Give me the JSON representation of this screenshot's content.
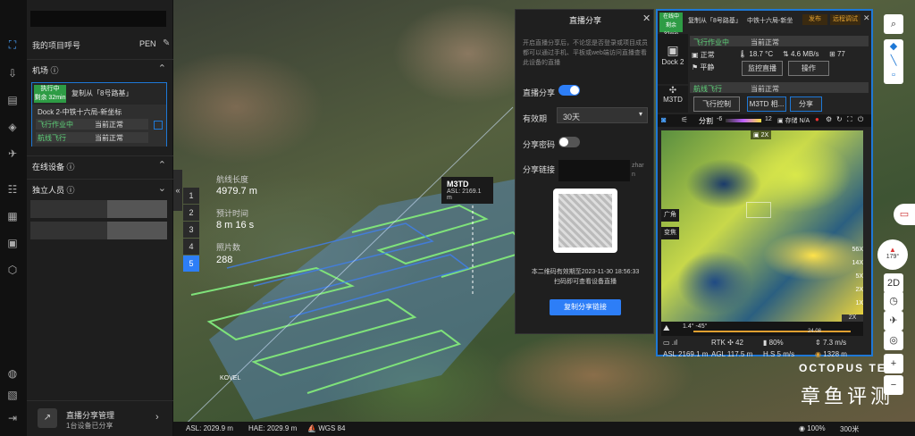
{
  "panel": {
    "project_title": "我的项目呼号",
    "user": "PEN",
    "dock_section": "机场",
    "dock_card": {
      "status_badge": "执行中",
      "time_badge": "剩余 32min",
      "task": "复制从「8号路基」",
      "name": "Dock 2-中铁十六局-新坐标",
      "row1_left": "飞行作业中",
      "row1_right": "当前正常",
      "row2_left": "航线飞行",
      "row2_right": "当前正常"
    },
    "online_section": "在线设备",
    "personnel_section": "独立人员",
    "live_manage": "直播分享管理",
    "live_sub": "1台设备已分享"
  },
  "map": {
    "m3td_label": "M3TD",
    "m3td_asl": "ASL: 2169.1 m",
    "route_length_label": "航线长度",
    "route_length": "4979.7 m",
    "est_time_label": "预计时间",
    "est_time": "8 m 16 s",
    "photo_count_label": "照片数",
    "photo_count": "288",
    "waypoints": [
      "1",
      "2",
      "3",
      "4",
      "5"
    ],
    "place_label": "KOVEL",
    "watermark_en": "OCTOPUS TEST",
    "watermark_cn": "章鱼评测"
  },
  "share_dialog": {
    "title": "直播分享",
    "desc": "开启直播分享后，不论您是否登录或项目成员都可以通过手机、平板或web端访问直播查看此设备的直播",
    "live_share_label": "直播分享",
    "validity_label": "有效期",
    "validity_value": "30天",
    "password_label": "分享密码",
    "link_label": "分享链接",
    "link_tail": "zhar\nn",
    "expire_text": "本二维码有效期至2023-11-30 18:56:33",
    "scan_text": "扫码即可查看设备直播",
    "copy_button": "复制分享链接"
  },
  "drone_panel": {
    "header_badge1": "在线中",
    "header_badge2": "剩余 32min",
    "header_task": "复制从「8号路基」",
    "header_name": "中铁十六局-新坐",
    "header_btn1": "发布",
    "header_btn2": "远程调试",
    "dock_label": "Dock 2",
    "dock_status": "飞行作业中",
    "dock_status_right": "当前正常",
    "dock_stat1": "正常",
    "dock_temp": "18.7 °C",
    "dock_speed": "4.6 MB/s",
    "dock_count": "77",
    "dock_stat2": "平静",
    "dock_btn1": "监控直播",
    "dock_btn2": "操作",
    "drone_label": "M3TD",
    "drone_status": "航线飞行",
    "drone_status_right": "当前正常",
    "drone_btn1": "飞行控制",
    "drone_btn2": "M3TD 相...",
    "drone_btn3": "分享",
    "cam_mode": "分割",
    "cam_low": "-6",
    "cam_high": "12",
    "storage": "存储 N/A",
    "thermal_label": "广角",
    "thermal_label2": "变焦",
    "zoom_levels": [
      "56X",
      "14X",
      "5X",
      "2X",
      "1X"
    ],
    "zoom_current": "2X",
    "gimbal": "1.4° -45°",
    "timeline_val": "24.08",
    "zoom_box": "2X",
    "signal": ".ıl",
    "rtk": "RTK",
    "rtk_val": "42",
    "battery": "80%",
    "vs": "7.3 m/s",
    "asl": "ASL 2169.1 m",
    "agl": "AGL 117.5 m",
    "hs": "H.S 5 m/s",
    "dist": "1328 m"
  },
  "right_bar": {
    "compass": "179°",
    "btn_2d": "2D"
  },
  "status_bar": {
    "asl": "ASL: 2029.9 m",
    "hae": "HAE: 2029.9 m",
    "crs": "WGS 84",
    "zoom": "100%",
    "scale": "300米"
  }
}
